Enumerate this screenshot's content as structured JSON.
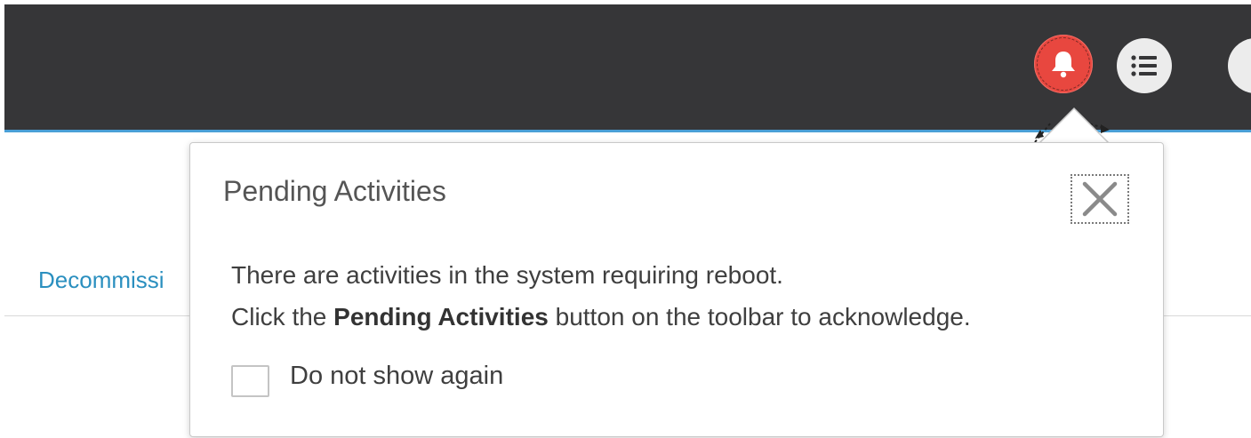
{
  "toolbar": {
    "background_color": "#363638",
    "accent_line_color": "#4a9fd6",
    "notifications_icon": "bell-icon",
    "notifications_color": "#e8473f",
    "list_icon": "list-icon",
    "help_icon": "help-icon"
  },
  "page": {
    "link_text": "Decommissi",
    "link_color": "#2a8fbf"
  },
  "popover": {
    "title": "Pending Activities",
    "close_icon": "close-icon",
    "message_line1": "There are activities in the system requiring reboot.",
    "message_line2_prefix": "Click the ",
    "message_line2_bold": "Pending Activities",
    "message_line2_suffix": " button on the toolbar to acknowledge.",
    "checkbox_label": "Do not show again",
    "checkbox_checked": false
  }
}
